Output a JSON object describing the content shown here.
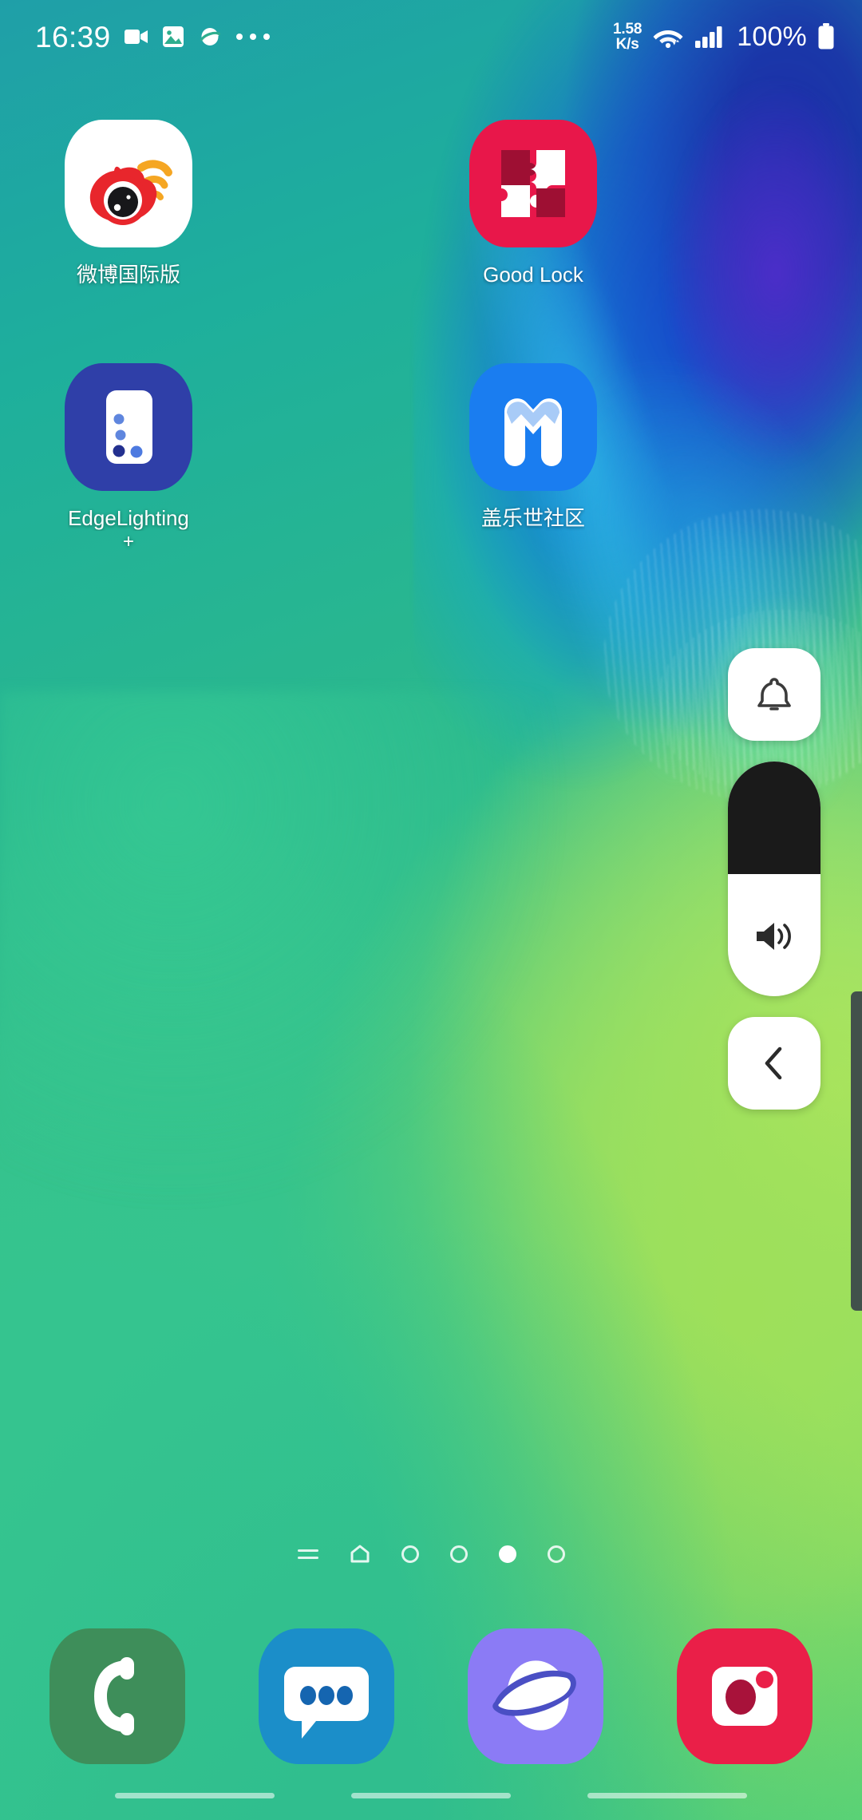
{
  "status_bar": {
    "clock": "16:39",
    "left_icons": [
      "video-camera-icon",
      "gallery-icon",
      "browser-icon",
      "more-dots-icon"
    ],
    "network_speed_value": "1.58",
    "network_speed_unit": "K/s",
    "right_icons": [
      "wifi-icon",
      "signal-bars-icon"
    ],
    "battery_percent": "100%",
    "battery_icon": "battery-full-icon"
  },
  "home": {
    "rows": [
      {
        "apps": [
          {
            "label": "微博国际版",
            "sublabel": "",
            "icon": "weibo-icon",
            "bg": "#ffffff"
          },
          {
            "label": "Good Lock",
            "sublabel": "",
            "icon": "goodlock-puzzle-icon",
            "bg": "#e8174a"
          }
        ]
      },
      {
        "apps": [
          {
            "label": "EdgeLighting",
            "sublabel": "+",
            "icon": "edgelighting-icon",
            "bg": "#2f3fa8"
          },
          {
            "label": "盖乐世社区",
            "sublabel": "",
            "icon": "galaxy-community-m-icon",
            "bg": "#1a7df0"
          }
        ]
      }
    ]
  },
  "volume_panel": {
    "bell_icon": "bell-icon",
    "speaker_icon": "speaker-volume-icon",
    "back_icon": "chevron-left-icon",
    "level_percent": 52,
    "fill_percent_from_top": 48,
    "fill_color": "#1a1a1a",
    "track_color": "#ffffff"
  },
  "page_indicator": {
    "items": [
      {
        "type": "lines-icon",
        "active": false
      },
      {
        "type": "home-icon",
        "active": false
      },
      {
        "type": "dot",
        "active": false
      },
      {
        "type": "dot",
        "active": false
      },
      {
        "type": "dot",
        "active": true
      },
      {
        "type": "dot",
        "active": false
      }
    ]
  },
  "dock": {
    "items": [
      {
        "name": "phone",
        "icon": "phone-icon",
        "bg": "#3e8e5a"
      },
      {
        "name": "messages",
        "icon": "message-bubble-icon",
        "bg": "#1b8ec9"
      },
      {
        "name": "browser",
        "icon": "internet-planet-icon",
        "bg": "#8b7bf5"
      },
      {
        "name": "camera",
        "icon": "camera-icon",
        "bg": "#ea1f48"
      }
    ]
  },
  "gesture_bar": {
    "pills": 3
  }
}
